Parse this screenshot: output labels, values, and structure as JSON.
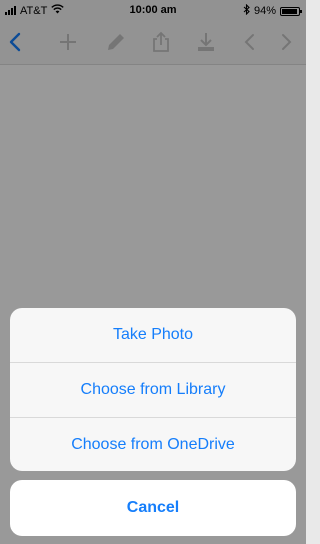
{
  "status_bar": {
    "carrier": "AT&T",
    "time": "10:00 am",
    "battery_percent": "94%",
    "battery_level": 0.94,
    "icons": [
      "signal-icon",
      "wifi-icon",
      "bluetooth-icon",
      "battery-icon"
    ]
  },
  "toolbar": {
    "icons": [
      "back-chevron-icon",
      "add-icon",
      "edit-pencil-icon",
      "share-icon",
      "download-icon",
      "previous-chevron-icon",
      "next-chevron-icon"
    ],
    "accent_color": "#157efb",
    "disabled_color": "#c4c4c4"
  },
  "action_sheet": {
    "options": [
      {
        "label": "Take Photo"
      },
      {
        "label": "Choose from Library"
      },
      {
        "label": "Choose from OneDrive"
      }
    ],
    "cancel_label": "Cancel",
    "text_color": "#157efb"
  }
}
